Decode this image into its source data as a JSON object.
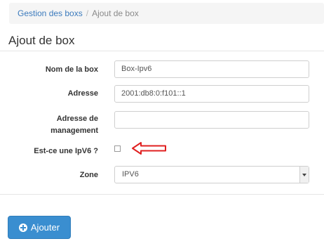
{
  "breadcrumb": {
    "items": [
      "Gestion des boxs",
      "Ajout de box"
    ],
    "separator": "/"
  },
  "page": {
    "title": "Ajout de box"
  },
  "form": {
    "box_name": {
      "label": "Nom de la box",
      "value": "Box-Ipv6"
    },
    "address": {
      "label": "Adresse",
      "value": "2001:db8:0:f101::1"
    },
    "mgmt_address": {
      "label_line1": "Adresse de",
      "label_line2": "management",
      "value": ""
    },
    "ipv6": {
      "label": "Est-ce une IpV6 ?",
      "checked": false
    },
    "zone": {
      "label": "Zone",
      "selected": "IPV6"
    }
  },
  "actions": {
    "add_label": "Ajouter",
    "add_icon": "plus-circle-icon"
  },
  "colors": {
    "accent": "#3a8ed0",
    "annotation_arrow": "#e02020",
    "link": "#3c7bbd"
  }
}
